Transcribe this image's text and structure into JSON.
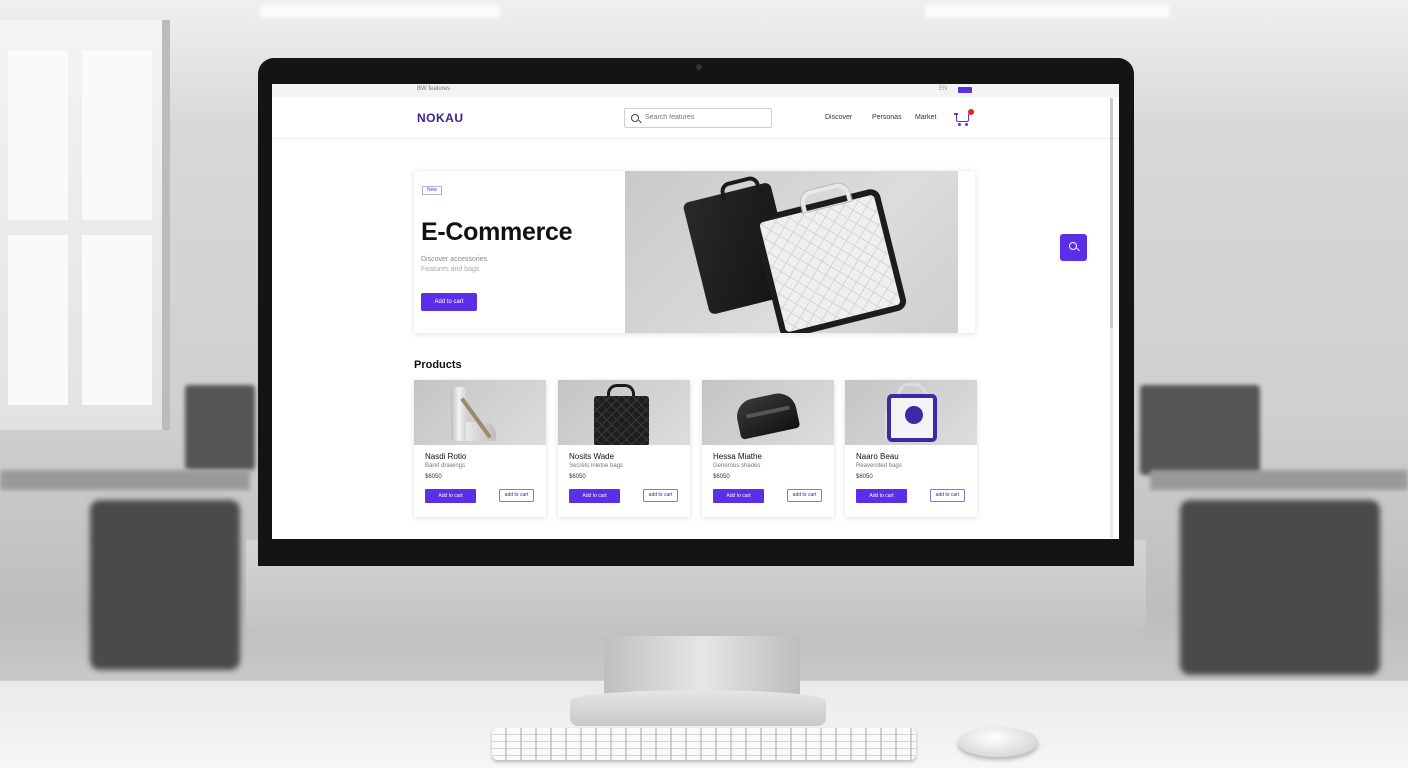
{
  "topbar": {
    "left_text": "BW features",
    "right_text": "EN"
  },
  "header": {
    "logo": "NOKAU",
    "search": {
      "placeholder": "Search features"
    },
    "nav": [
      "Discover",
      "Personas",
      "Market"
    ],
    "cart": {
      "icon": "cart-icon",
      "badge_color": "#e0241b"
    }
  },
  "hero": {
    "badge": "New",
    "title": "E-Commerce",
    "subtitle_line1": "Discover accessories",
    "subtitle_line2": "Features and bags",
    "cta": "Add to cart"
  },
  "floating_search": {
    "icon": "search-icon"
  },
  "products": {
    "title": "Products",
    "items": [
      {
        "name": "Nasdi Rotio",
        "desc": "Baret drawings",
        "price": "$6050",
        "add": "Add to cart",
        "secondary": "add to cart"
      },
      {
        "name": "Nosits Wade",
        "desc": "Secrets inletse bags",
        "price": "$6050",
        "add": "Add to cart",
        "secondary": "add to cart"
      },
      {
        "name": "Hessa Miathe",
        "desc": "Generous shades",
        "price": "$6050",
        "add": "Add to cart",
        "secondary": "add to cart"
      },
      {
        "name": "Naaro Beau",
        "desc": "Reaveroted bags",
        "price": "$6050",
        "add": "Add to cart",
        "secondary": "add to cart"
      }
    ]
  },
  "colors": {
    "accent": "#5b2ee8",
    "brand": "#3a1f8f",
    "badge": "#e0241b"
  }
}
